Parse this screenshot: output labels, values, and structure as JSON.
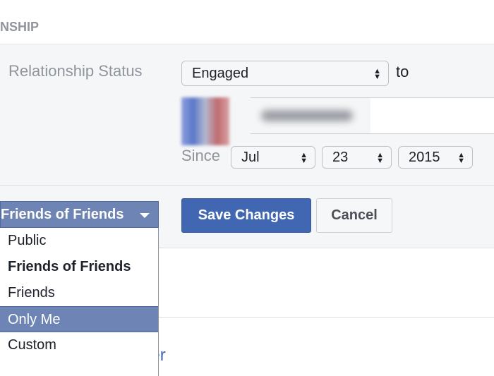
{
  "header": {
    "section_title": "NSHIP"
  },
  "relationship": {
    "label": "Relationship Status",
    "status_value": "Engaged",
    "to_label": "to",
    "since_label": "Since",
    "month": "Jul",
    "day": "23",
    "year": "2015"
  },
  "buttons": {
    "save": "Save Changes",
    "cancel": "Cancel"
  },
  "privacy": {
    "selected": "Friends of Friends",
    "options": [
      "Public",
      "Friends of Friends",
      "Friends",
      "Only Me",
      "Custom"
    ],
    "highlighted": "Only Me"
  },
  "link_partial": "ber",
  "colors": {
    "accent": "#4267b2",
    "menu_highlight": "#6d84b4",
    "panel_bg": "#f5f6f7"
  }
}
